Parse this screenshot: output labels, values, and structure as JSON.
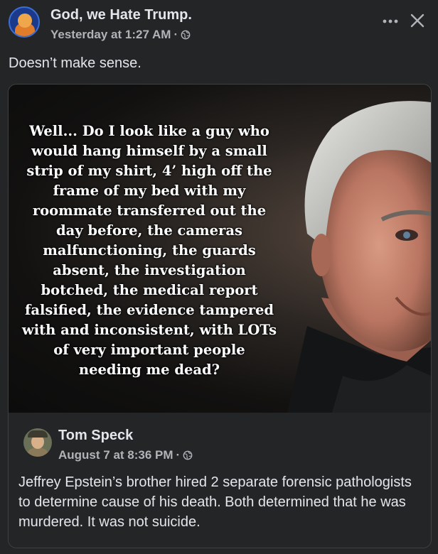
{
  "post": {
    "group_name": "God, we Hate Trump.",
    "timestamp": "Yesterday at 1:27 AM",
    "separator": "·",
    "privacy_icon": "globe-icon",
    "text": "Doesn’t make sense."
  },
  "actions": {
    "more_icon": "more-dots-icon",
    "close_icon": "close-icon"
  },
  "meme": {
    "caption_lines": [
      "Well... Do I look like a guy who",
      "would hang himself by a small",
      "strip of my shirt, 4’ high off the",
      "frame of my bed with my",
      "roommate transferred out the",
      "day before, the cameras",
      "malfunctioning, the guards",
      "absent, the investigation",
      "botched, the medical report",
      "falsified, the evidence tampered",
      "with and inconsistent, with LOTs",
      "of very important people",
      "needing me dead?"
    ]
  },
  "shared_post": {
    "author": "Tom Speck",
    "timestamp": "August 7 at 8:36 PM",
    "separator": "·",
    "privacy_icon": "globe-icon",
    "text": "Jeffrey Epstein’s brother hired 2 separate forensic pathologists to determine cause of his death. Both determined that he was murdered. It was not suicide."
  }
}
